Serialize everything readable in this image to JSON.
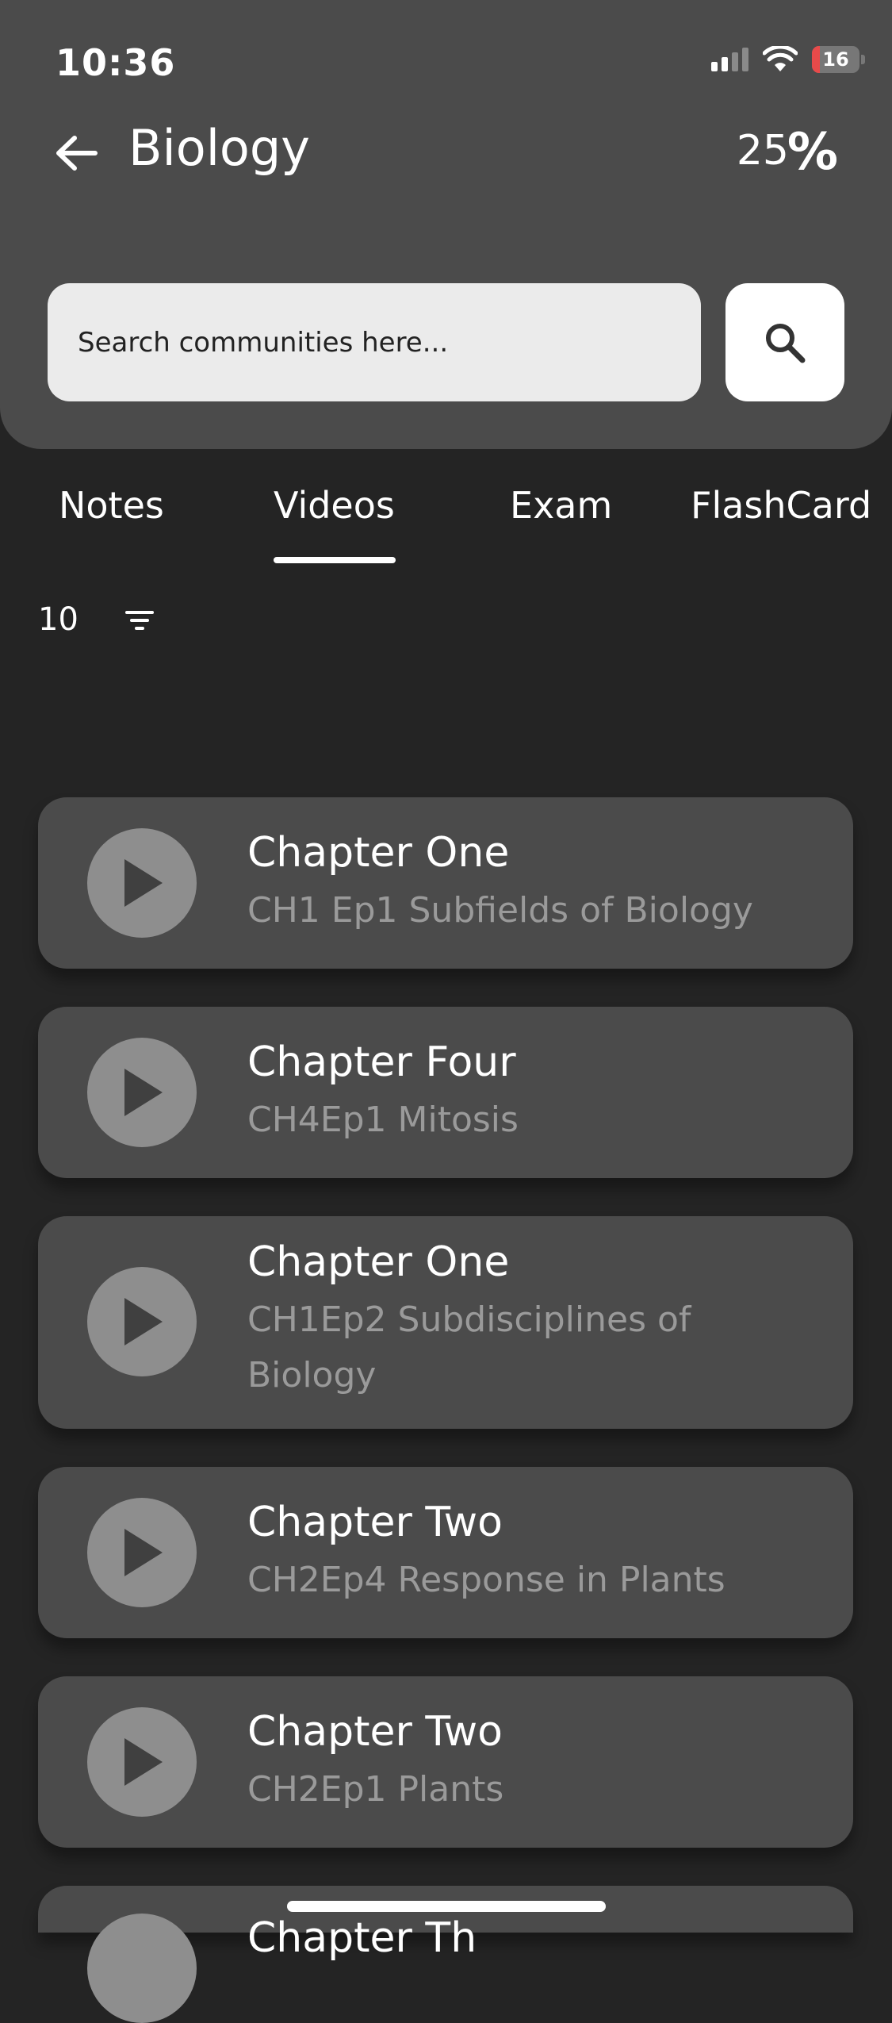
{
  "status_bar": {
    "time": "10:36",
    "battery": "16",
    "battery_level": 0.16
  },
  "header": {
    "title": "Biology",
    "progress_value": "25",
    "progress_icon": "percent-icon"
  },
  "search": {
    "placeholder": "Search communities here..."
  },
  "tabs": [
    {
      "label": "Notes"
    },
    {
      "label": "Videos",
      "active": true
    },
    {
      "label": "Exam"
    },
    {
      "label": "FlashCard"
    }
  ],
  "list": {
    "count": "10",
    "items": [
      {
        "title": "Chapter One",
        "subtitle": "CH1 Ep1 Subfields of Biology"
      },
      {
        "title": "Chapter Four",
        "subtitle": "CH4Ep1 Mitosis"
      },
      {
        "title": "Chapter One",
        "subtitle": "CH1Ep2 Subdisciplines of Biology"
      },
      {
        "title": "Chapter Two",
        "subtitle": "CH2Ep4 Response in Plants"
      },
      {
        "title": "Chapter Two",
        "subtitle": "CH2Ep1 Plants"
      },
      {
        "title": "Chapter Th"
      }
    ]
  },
  "colors": {
    "background": "#242424",
    "header": "#4b4b4b",
    "card": "#4b4b4b",
    "play_button": "#8e8e8e",
    "subtitle": "#9a9a9a"
  }
}
